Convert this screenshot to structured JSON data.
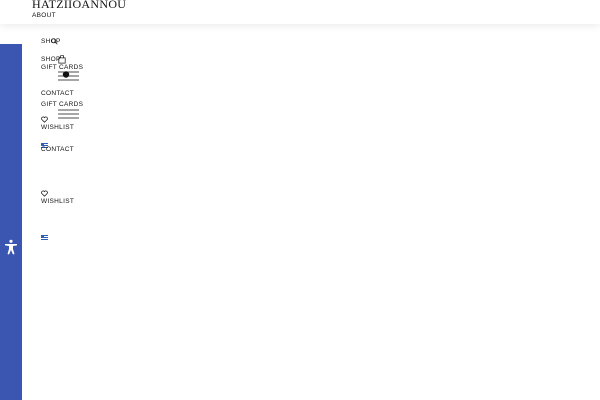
{
  "brand": {
    "logo_text": "HATZIIOANNOU"
  },
  "nav_primary": {
    "about": "ABOUT",
    "shop": "SHOP",
    "shop_2": "SHOP",
    "gift_cards": "GIFT CARDS",
    "contact": "CONTACT",
    "gift_cards_2": "GIFT CARDS",
    "wishlist": "WISHLIST",
    "contact_2": "CONTACT",
    "wishlist_2": "WISHLIST"
  },
  "icons": {
    "search": "search-icon",
    "bag": "shopping-bag-icon",
    "menu": "menu-icon",
    "heart": "heart-icon",
    "flag": "greek-flag-icon",
    "accessibility": "accessibility-icon"
  },
  "colors": {
    "accent_blue": "#3b56b0",
    "text": "#111111",
    "background": "#ffffff"
  }
}
